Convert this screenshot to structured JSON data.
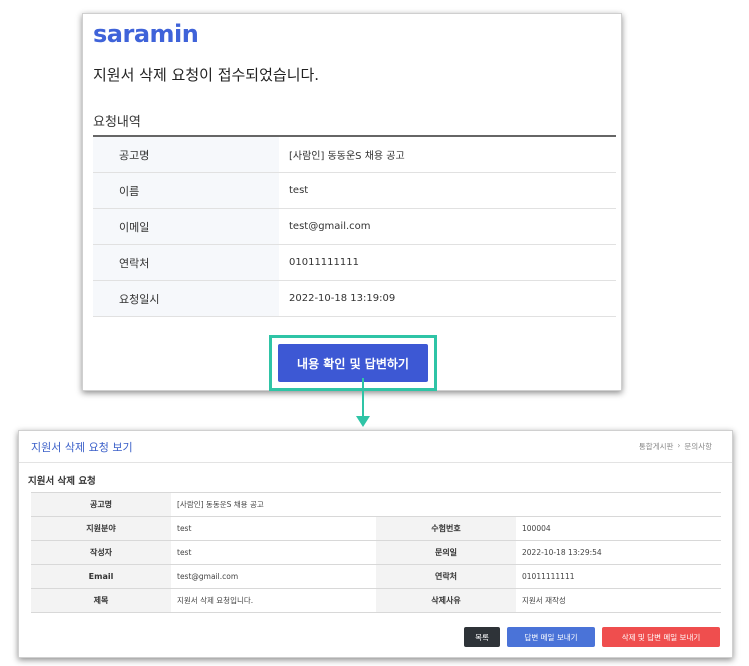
{
  "email": {
    "logo": "saramin",
    "headline": "지원서 삭제 요청이 접수되었습니다.",
    "section_title": "요청내역",
    "rows": [
      {
        "label": "공고명",
        "value": "[사람인] 동동운S 채용 공고"
      },
      {
        "label": "이름",
        "value": "test"
      },
      {
        "label": "이메일",
        "value": "test@gmail.com"
      },
      {
        "label": "연락처",
        "value": "01011111111"
      },
      {
        "label": "요청일시",
        "value": "2022-10-18 13:19:09"
      }
    ],
    "cta_label": "내용 확인 및 답변하기"
  },
  "admin": {
    "title": "지원서 삭제 요청 보기",
    "breadcrumb": [
      "통합게시판",
      "›",
      "문의사항"
    ],
    "detail_title": "지원서 삭제 요청",
    "posting": {
      "label": "공고명",
      "value": "[사람인] 동동운S 채용 공고"
    },
    "pairs": [
      {
        "label1": "지원분야",
        "value1": "test",
        "label2": "수험번호",
        "value2": "100004"
      },
      {
        "label1": "작성자",
        "value1": "test",
        "label2": "문의일",
        "value2": "2022-10-18 13:29:54"
      },
      {
        "label1": "Email",
        "value1": "test@gmail.com",
        "label2": "연락처",
        "value2": "01011111111"
      },
      {
        "label1": "제목",
        "value1": "지원서 삭제 요청입니다.",
        "label2": "삭제사유",
        "value2": "지원서 재작성"
      }
    ],
    "buttons": {
      "list": "목록",
      "reply": "답변 메일 보내기",
      "delete_reply": "삭제 및 답변 메일 보내기"
    },
    "colors": {
      "list": "#2e3338",
      "reply": "#4a73d8",
      "delete": "#ef4e4e"
    }
  },
  "colors": {
    "brand": "#3f63d9",
    "cta": "#3d58d4",
    "highlight": "#2fc4a6"
  }
}
